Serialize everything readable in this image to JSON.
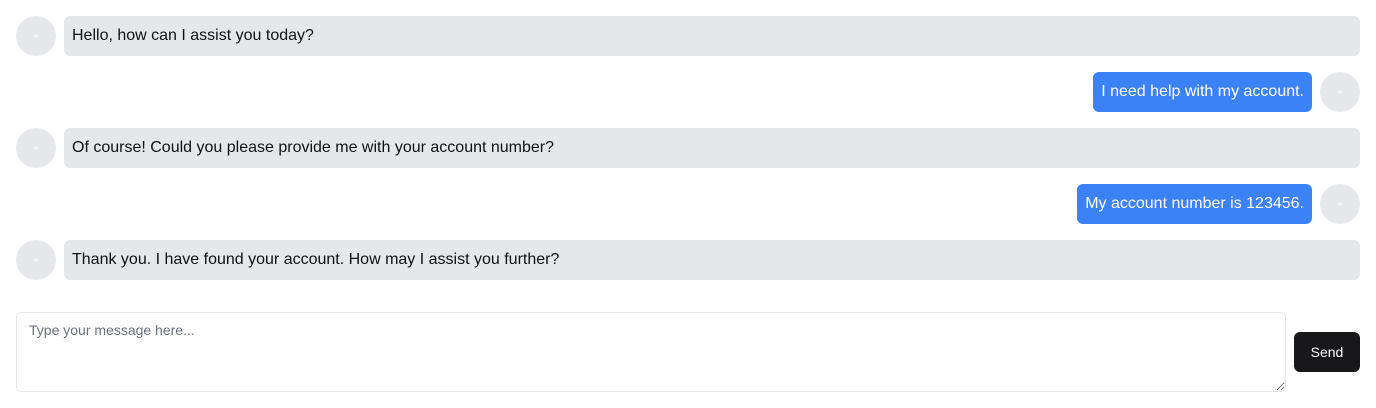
{
  "messages": [
    {
      "sender": "bot",
      "text": "Hello, how can I assist you today?"
    },
    {
      "sender": "user",
      "text": "I need help with my account."
    },
    {
      "sender": "bot",
      "text": "Of course! Could you please provide me with your account number?"
    },
    {
      "sender": "user",
      "text": "My account number is 123456."
    },
    {
      "sender": "bot",
      "text": "Thank you. I have found your account. How may I assist you further?"
    }
  ],
  "composer": {
    "placeholder": "Type your message here...",
    "value": "",
    "send_label": "Send"
  },
  "colors": {
    "bot_bubble": "#e5e7eb",
    "user_bubble": "#3b82f6",
    "send_button": "#18181b",
    "avatar": "#e5e7eb"
  }
}
